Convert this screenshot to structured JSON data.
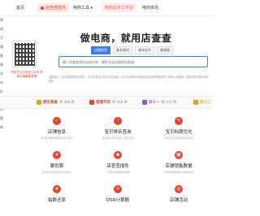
{
  "nav": {
    "home": "首页",
    "plugin": "店查查插件",
    "tools": "电商工具",
    "cloud": "电商云手工平台",
    "news": "电商资讯"
  },
  "left_strip": [
    "频",
    "道",
    "开",
    "通",
    "客",
    "服",
    "发",
    "布",
    "反",
    "馈",
    "问",
    "题",
    "联"
  ],
  "qr_caption": "扫码关注店查查公众号 获取店铺最新数据",
  "hero": {
    "title": "做电商，就用店查查",
    "tabs": [
      "店铺信息",
      "查关键词",
      "查淘宝号",
      "查销量"
    ],
    "search_placeholder": "输入您要查询的店铺名称、掌柜名或店铺网址链接"
  },
  "notice": "温馨提示：店查查数据仅供参考，请勿将其用于任何非法用途。本平台所提供店铺信息及运营数据来源于网络公开数据，如有侵权请联系我们删除。",
  "sections": [
    {
      "label": "黑名单查",
      "count": "共 388 条",
      "color": "#f39c12"
    },
    {
      "label": "直播节目",
      "count": "共 310 条",
      "color": "#e8452c"
    },
    {
      "label": "双十一",
      "count": "共 272 条",
      "color": "#9b59b6"
    },
    {
      "label": "双十二",
      "count": "",
      "color": "#f39c12"
    }
  ],
  "cards": [
    {
      "title": "店铺信息",
      "desc": "查询店铺信用等级及开店时间",
      "icon": "✓"
    },
    {
      "title": "宝贝排名查询",
      "desc": "查询宝贝搜索排名，提升流量",
      "icon": "↑"
    },
    {
      "title": "宝贝标题优化",
      "desc": "优化宝贝标题提高搜索排名",
      "icon": "✎"
    },
    {
      "title": "聚划算",
      "desc": "查询聚划算报名和活动信息",
      "icon": "♥"
    },
    {
      "title": "店查查插件",
      "desc": "一键查询店铺宝贝数据",
      "icon": "◆"
    },
    {
      "title": "店铺销售数据",
      "desc": "查询店铺销量和月销量数据",
      "icon": "▣"
    },
    {
      "title": "指数还原",
      "desc": "",
      "icon": "★"
    },
    {
      "title": "DSR计算器",
      "desc": "",
      "icon": "≡"
    },
    {
      "title": "店铺活动",
      "desc": "",
      "icon": "◎"
    }
  ]
}
